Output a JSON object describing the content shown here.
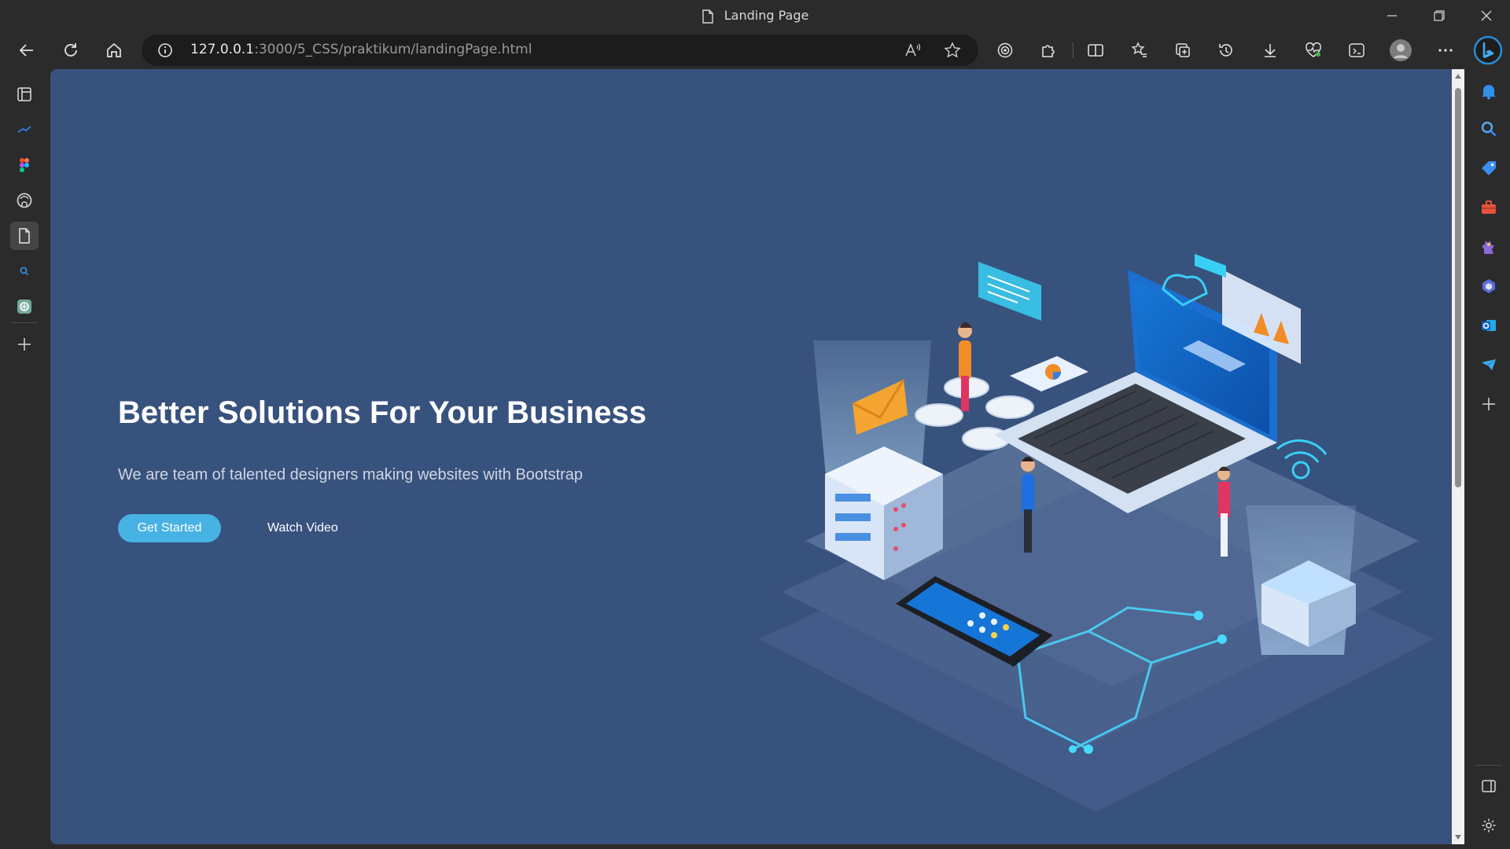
{
  "window": {
    "title": "Landing Page",
    "icons": [
      "page-icon",
      "minimize-icon",
      "restore-icon",
      "close-icon"
    ]
  },
  "toolbar": {
    "url_host": "127.0.0.1",
    "url_rest": ":3000/5_CSS/praktikum/landingPage.html",
    "icons": [
      "back-arrow-icon",
      "refresh-icon",
      "home-icon",
      "site-info-icon",
      "read-aloud-icon",
      "favorite-star-icon",
      "tracking-prevention-icon",
      "extensions-icon",
      "split-screen-icon",
      "favorites-icon",
      "collections-icon",
      "history-icon",
      "download-icon",
      "performance-icon",
      "screenshot-icon",
      "profile-avatar",
      "more-options-icon",
      "bing-chat-icon"
    ]
  },
  "left_sidebar": {
    "icons": [
      "tab-actions-icon",
      "pinned-tab-icon",
      "figma-icon",
      "github-icon",
      "document-icon",
      "search-tab-icon",
      "chatgpt-icon",
      "add-tab-icon"
    ]
  },
  "right_sidebar": {
    "icons": [
      "notifications-icon",
      "search-icon",
      "shopping-tag-icon",
      "tools-icon",
      "games-icon",
      "microsoft365-icon",
      "outlook-icon",
      "telegram-icon",
      "add-icon",
      "sidebar-toggle-icon",
      "settings-gear-icon"
    ]
  },
  "hero": {
    "title": "Better Solutions For Your Business",
    "subtitle": "We are team of talented designers making websites with Bootstrap",
    "cta_primary": "Get Started",
    "cta_secondary": "Watch Video"
  },
  "colors": {
    "page_background": "#38527e",
    "cta_button": "#47b2e4",
    "browser_chrome": "#2b2b2b"
  },
  "illustration": {
    "icon": "isometric-tech-illustration"
  }
}
